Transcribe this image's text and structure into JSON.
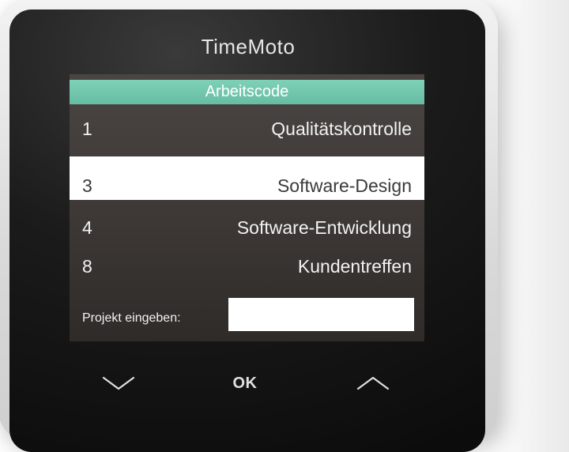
{
  "brand": "TimeMoto",
  "header": {
    "title": "Arbeitscode"
  },
  "items": [
    {
      "number": "1",
      "label": "Qualitätskontrolle"
    },
    {
      "number": "3",
      "label": "Software-Design",
      "selected": true
    },
    {
      "number": "4",
      "label": "Software-Entwicklung"
    },
    {
      "number": "8",
      "label": "Kundentreffen"
    }
  ],
  "input": {
    "label": "Projekt eingeben:",
    "value": ""
  },
  "buttons": {
    "down_icon": "chevron-down-icon",
    "ok_label": "OK",
    "up_icon": "chevron-up-icon"
  },
  "colors": {
    "header_accent": "#6fc6aa",
    "selected_bg": "#ffffff",
    "screen_bg": "#3d3836"
  }
}
